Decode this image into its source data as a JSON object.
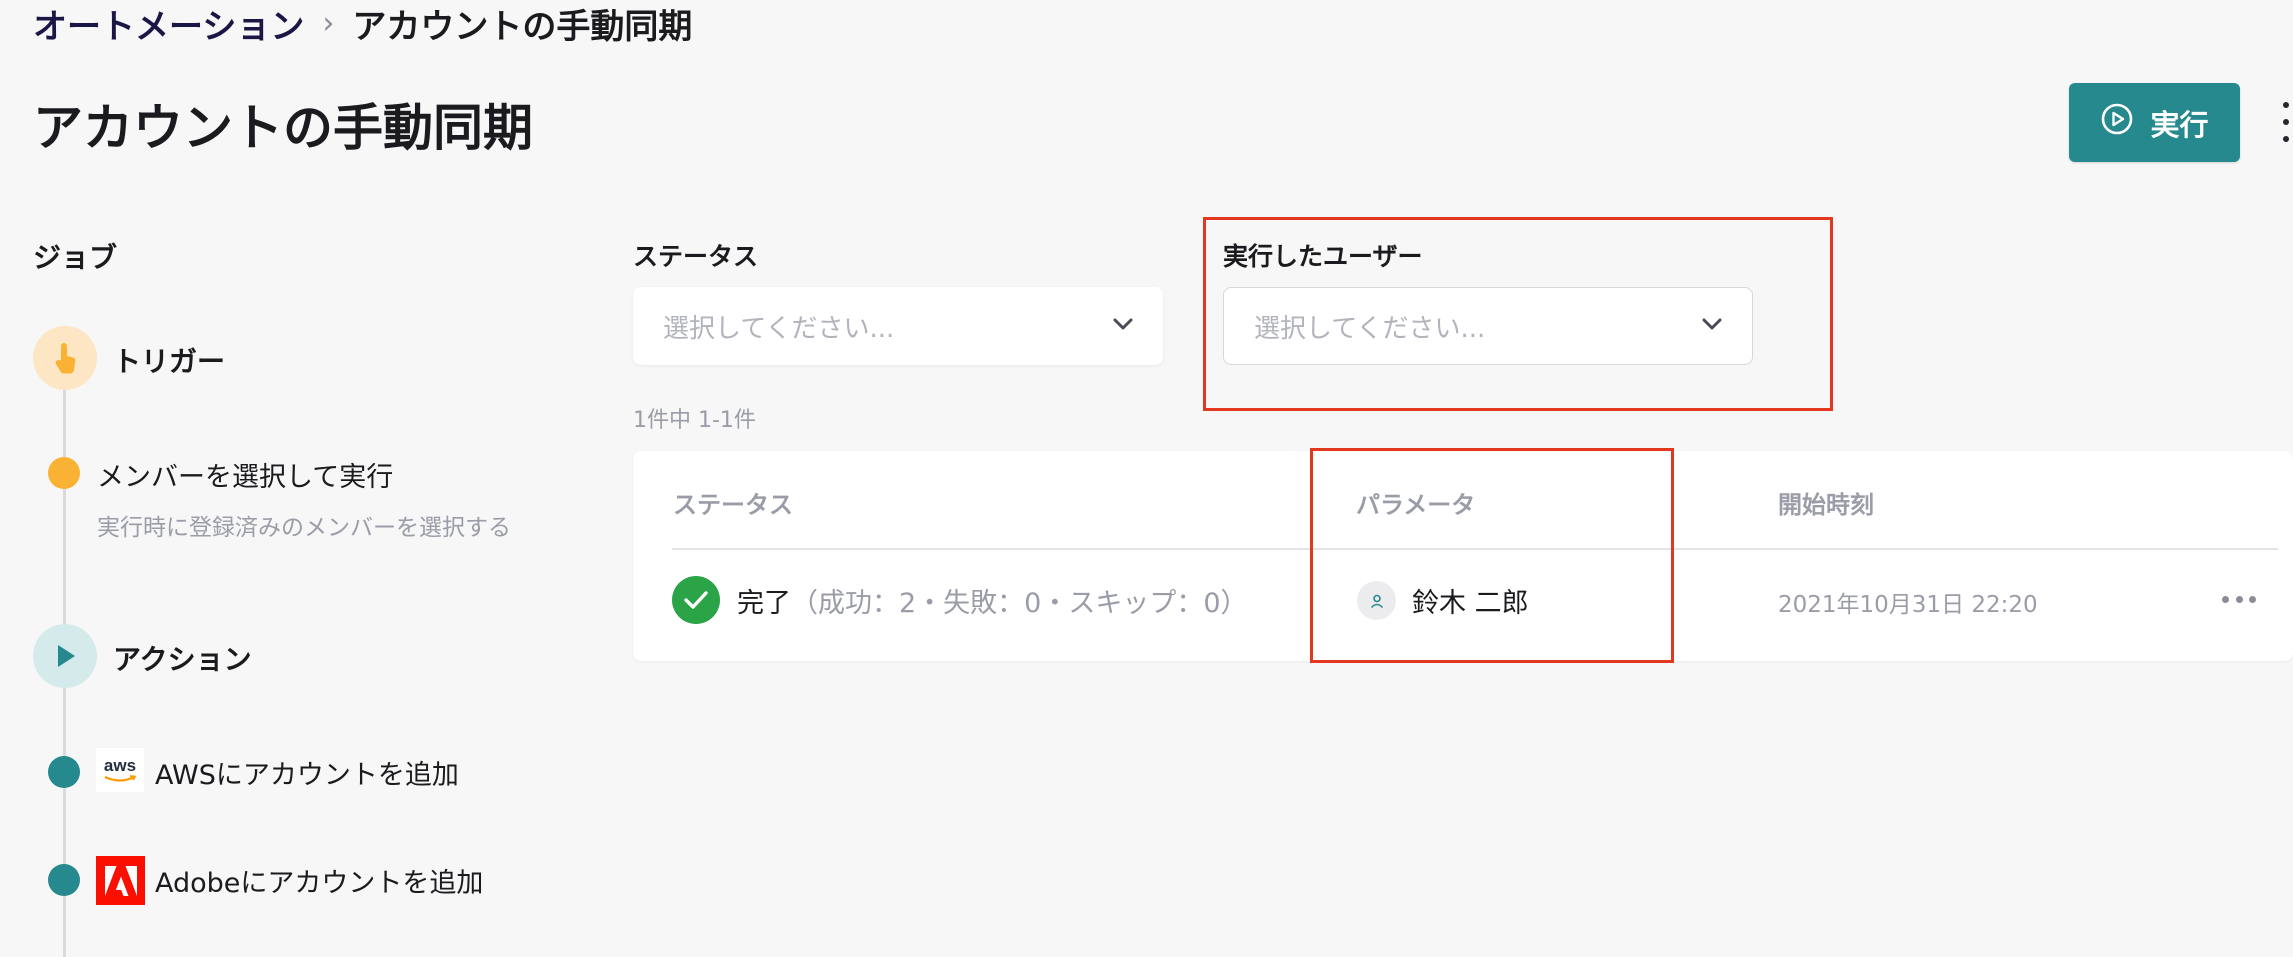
{
  "breadcrumb": {
    "parent": "オートメーション",
    "separator": "›",
    "current": "アカウントの手動同期"
  },
  "page_title": "アカウントの手動同期",
  "run_button_label": "実行",
  "sidebar": {
    "jobs_label": "ジョブ",
    "trigger_label": "トリガー",
    "trigger_step": {
      "label": "メンバーを選択して実行",
      "description": "実行時に登録済みのメンバーを選択する"
    },
    "action_label": "アクション",
    "action_steps": [
      {
        "label": "AWSにアカウントを追加",
        "logo": "aws"
      },
      {
        "label": "Adobeにアカウントを追加",
        "logo": "Adobe"
      }
    ]
  },
  "filters": {
    "status": {
      "label": "ステータス",
      "placeholder": "選択してください..."
    },
    "user": {
      "label": "実行したユーザー",
      "placeholder": "選択してください..."
    }
  },
  "result_count": "1件中 1-1件",
  "table": {
    "headers": {
      "status": "ステータス",
      "parameter": "パラメータ",
      "start_time": "開始時刻"
    },
    "rows": [
      {
        "status": "完了",
        "status_detail": "（成功：2・失敗：0・スキップ：0）",
        "parameter_user": "鈴木 二郎",
        "start_time": "2021年10月31日 22:20"
      }
    ]
  },
  "colors": {
    "accent": "#25898e",
    "highlight_border": "#e4371f",
    "success": "#2aa446",
    "trigger": "#f9b233"
  },
  "icons": {
    "run_button": "play-circle-icon",
    "select": "chevron-down-icon",
    "trigger": "hand-pointer-icon",
    "action": "play-icon",
    "status": "check-circle-icon",
    "avatar": "user-icon",
    "row_menu": "more-horizontal-icon",
    "page_menu": "more-vertical-icon"
  }
}
